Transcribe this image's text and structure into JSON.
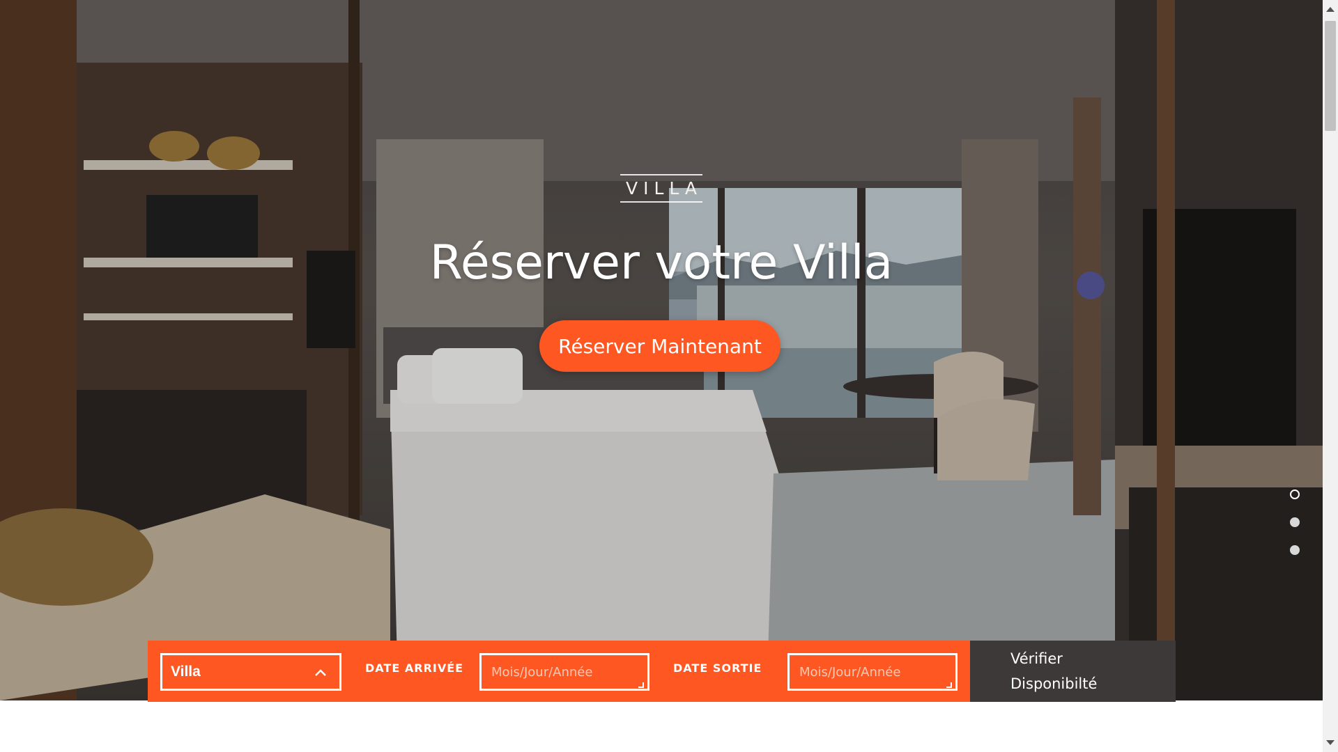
{
  "hero": {
    "brand": "VILLA",
    "headline": "Réserver votre Villa",
    "cta_label": "Réserver Maintenant",
    "slides": {
      "count": 3,
      "active_index": 0
    }
  },
  "booking": {
    "select_value": "Villa",
    "arrival_label": "DATE ARRIVÉE",
    "arrival_placeholder": "Mois/Jour/Année",
    "departure_label": "DATE SORTIE",
    "departure_placeholder": "Mois/Jour/Année",
    "check_line1": "Vérifier",
    "check_line2": "Disponibilté"
  },
  "icons": {
    "select_toggle": "chevron-up-icon",
    "hero_image": "hotel-room-photo"
  },
  "colors": {
    "accent": "#ff5722",
    "check_button_bg": "#3d3938",
    "text_light": "#ffffff"
  }
}
